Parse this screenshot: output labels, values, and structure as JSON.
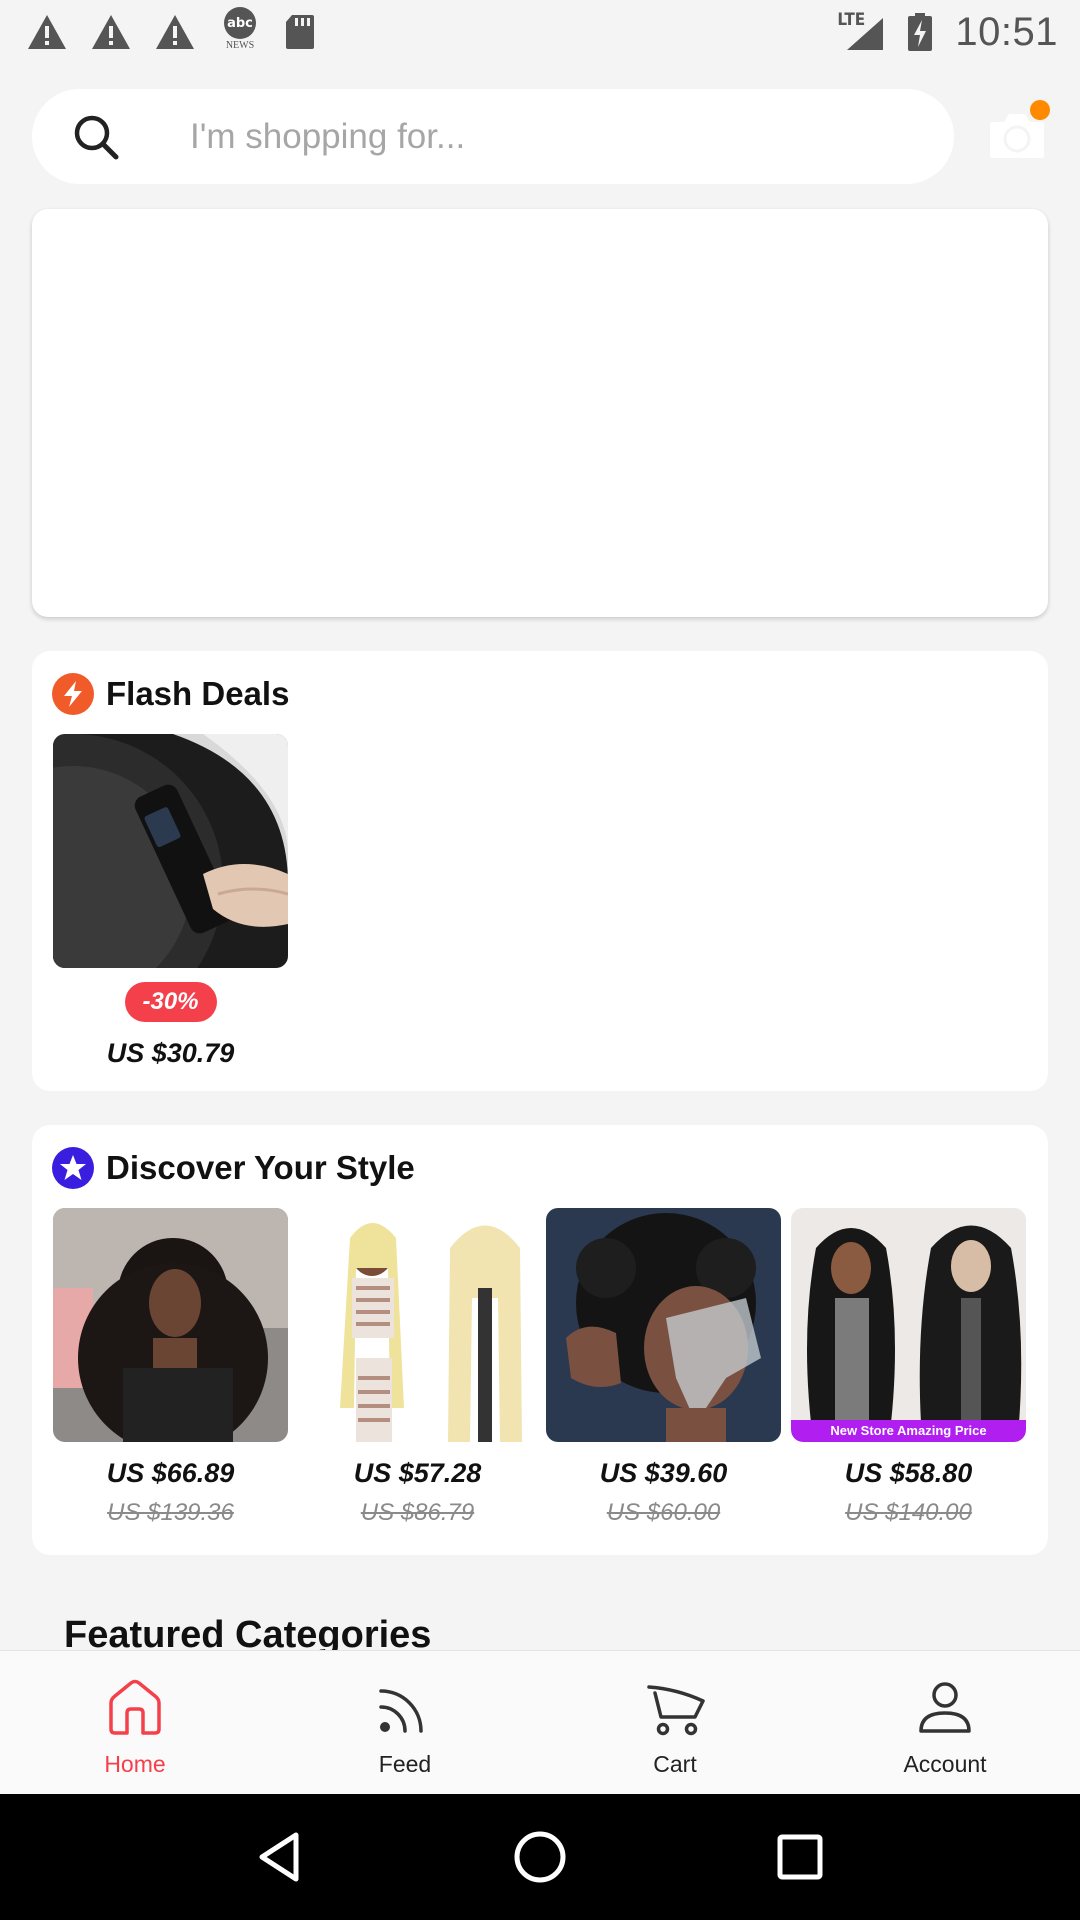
{
  "status_bar": {
    "time": "10:51",
    "network": "LTE",
    "left_icons": [
      "warning-icon",
      "warning-icon",
      "warning-icon",
      "abc-news-icon",
      "sd-card-icon"
    ],
    "abc_label": "abc",
    "news_label": "NEWS"
  },
  "search": {
    "placeholder": "I'm shopping for..."
  },
  "flash_deals": {
    "title": "Flash Deals",
    "items": [
      {
        "discount": "-30%",
        "price": "US $30.79"
      }
    ]
  },
  "discover": {
    "title": "Discover Your Style",
    "items": [
      {
        "price": "US $66.89",
        "old_price": "US $139.36"
      },
      {
        "price": "US $57.28",
        "old_price": "US $86.79"
      },
      {
        "price": "US $39.60",
        "old_price": "US $60.00"
      },
      {
        "price": "US $58.80",
        "old_price": "US $140.00"
      }
    ],
    "banner_text": "New Store Amazing Price"
  },
  "featured": {
    "title": "Featured Categories"
  },
  "bottom_nav": {
    "items": [
      {
        "label": "Home",
        "icon": "home-icon",
        "active": true
      },
      {
        "label": "Feed",
        "icon": "feed-icon",
        "active": false
      },
      {
        "label": "Cart",
        "icon": "cart-icon",
        "active": false
      },
      {
        "label": "Account",
        "icon": "account-icon",
        "active": false
      }
    ]
  },
  "colors": {
    "accent": "#f4404a",
    "flash_icon": "#f15a29",
    "discover_icon": "#3a1ee0",
    "notification_dot": "#ff8a00"
  }
}
